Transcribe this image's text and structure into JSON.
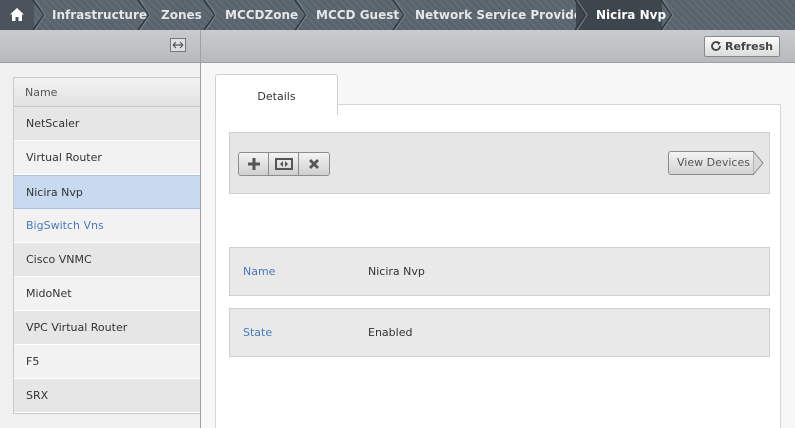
{
  "breadcrumb": {
    "items": [
      "Infrastructure",
      "Zones",
      "MCCDZone",
      "MCCD Guest",
      "Network Service Providers",
      "Nicira Nvp"
    ],
    "home_icon": "home-icon"
  },
  "left": {
    "column_header": "Name",
    "providers": [
      "NetScaler",
      "Virtual Router",
      "Nicira Nvp",
      "BigSwitch Vns",
      "Cisco VNMC",
      "MidoNet",
      "VPC Virtual Router",
      "F5",
      "SRX"
    ],
    "selected": "Nicira Nvp"
  },
  "right": {
    "refresh_label": "Refresh",
    "tab_label": "Details",
    "view_devices_label": "View Devices",
    "actions": [
      "add-icon",
      "enable-disable-icon",
      "remove-icon"
    ],
    "details": [
      {
        "label": "Name",
        "value": "Nicira Nvp"
      },
      {
        "label": "State",
        "value": "Enabled"
      }
    ]
  },
  "colors": {
    "link": "#4a7ab8",
    "selected_row": "#c8daf0",
    "breadcrumb_bg": "#59636d"
  }
}
